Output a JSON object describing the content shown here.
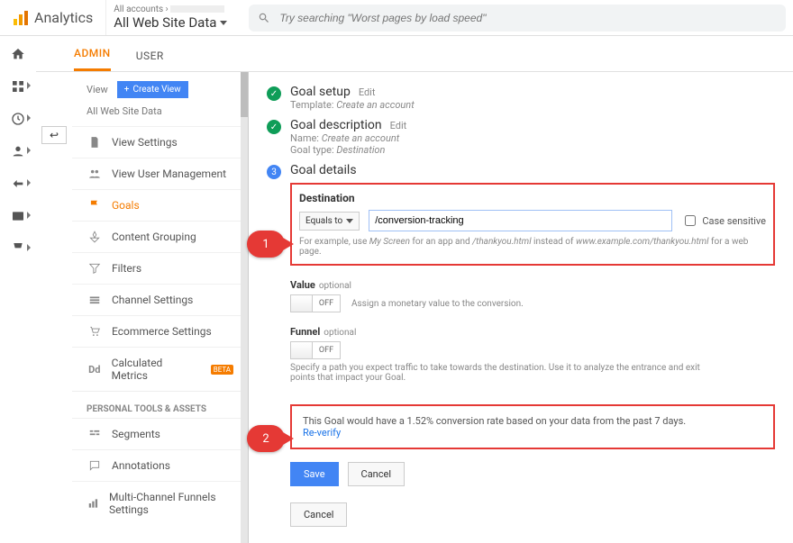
{
  "header": {
    "logo_text": "Analytics",
    "accounts_label": "All accounts",
    "view_name": "All Web Site Data",
    "search_placeholder": "Try searching \"Worst pages by load speed\""
  },
  "tabs": {
    "admin": "ADMIN",
    "user": "USER"
  },
  "sidebar": {
    "view_label": "View",
    "create_view": "Create View",
    "breadcrumb": "All Web Site Data",
    "items": [
      {
        "label": "View Settings"
      },
      {
        "label": "View User Management"
      },
      {
        "label": "Goals"
      },
      {
        "label": "Content Grouping"
      },
      {
        "label": "Filters"
      },
      {
        "label": "Channel Settings"
      },
      {
        "label": "Ecommerce Settings"
      },
      {
        "label": "Calculated Metrics",
        "badge": "BETA",
        "prefix": "Dd"
      }
    ],
    "section_header": "PERSONAL TOOLS & ASSETS",
    "items2": [
      {
        "label": "Segments"
      },
      {
        "label": "Annotations"
      },
      {
        "label": "Multi-Channel Funnels Settings"
      }
    ]
  },
  "steps": {
    "setup": {
      "title": "Goal setup",
      "edit": "Edit",
      "sub_label": "Template:",
      "sub_value": "Create an account"
    },
    "desc": {
      "title": "Goal description",
      "edit": "Edit",
      "name_label": "Name:",
      "name_value": "Create an account",
      "type_label": "Goal type:",
      "type_value": "Destination"
    },
    "details": {
      "num": "3",
      "title": "Goal details",
      "destination": {
        "label": "Destination",
        "match": "Equals to",
        "value": "/conversion-tracking",
        "case_sensitive": "Case sensitive",
        "hint_prefix": "For example, use ",
        "hint_my": "My Screen",
        "hint_mid": " for an app and ",
        "hint_ty": "/thankyou.html",
        "hint_mid2": " instead of ",
        "hint_url": "www.example.com/thankyou.html",
        "hint_suffix": " for a web page."
      },
      "value": {
        "label": "Value",
        "optional": "optional",
        "off": "OFF",
        "desc": "Assign a monetary value to the conversion."
      },
      "funnel": {
        "label": "Funnel",
        "optional": "optional",
        "off": "OFF",
        "desc": "Specify a path you expect traffic to take towards the destination. Use it to analyze the entrance and exit points that impact your Goal."
      },
      "verify": {
        "text": "This Goal would have a 1.52% conversion rate based on your data from the past 7 days.",
        "link": "Re-verify"
      },
      "save": "Save",
      "cancel_inner": "Cancel",
      "cancel_outer": "Cancel"
    }
  },
  "callouts": {
    "one": "1",
    "two": "2"
  }
}
